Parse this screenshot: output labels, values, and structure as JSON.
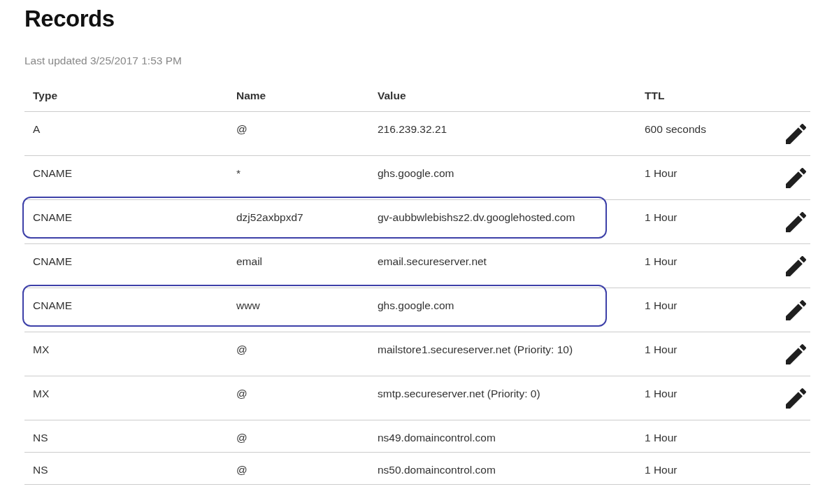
{
  "title": "Records",
  "last_updated": "Last updated 3/25/2017 1:53 PM",
  "table": {
    "columns": [
      "Type",
      "Name",
      "Value",
      "TTL"
    ],
    "rows": [
      {
        "type": "A",
        "name": "@",
        "value": "216.239.32.21",
        "ttl": "600 seconds",
        "editable": true,
        "highlighted": false
      },
      {
        "type": "CNAME",
        "name": "*",
        "value": "ghs.google.com",
        "ttl": "1 Hour",
        "editable": true,
        "highlighted": false
      },
      {
        "type": "CNAME",
        "name": "dzj52axbpxd7",
        "value": "gv-aubbwlebishsz2.dv.googlehosted.com",
        "ttl": "1 Hour",
        "editable": true,
        "highlighted": true
      },
      {
        "type": "CNAME",
        "name": "email",
        "value": "email.secureserver.net",
        "ttl": "1 Hour",
        "editable": true,
        "highlighted": false
      },
      {
        "type": "CNAME",
        "name": "www",
        "value": "ghs.google.com",
        "ttl": "1 Hour",
        "editable": true,
        "highlighted": true
      },
      {
        "type": "MX",
        "name": "@",
        "value": "mailstore1.secureserver.net (Priority: 10)",
        "ttl": "1 Hour",
        "editable": true,
        "highlighted": false
      },
      {
        "type": "MX",
        "name": "@",
        "value": "smtp.secureserver.net (Priority: 0)",
        "ttl": "1 Hour",
        "editable": true,
        "highlighted": false
      },
      {
        "type": "NS",
        "name": "@",
        "value": "ns49.domaincontrol.com",
        "ttl": "1 Hour",
        "editable": false,
        "highlighted": false
      },
      {
        "type": "NS",
        "name": "@",
        "value": "ns50.domaincontrol.com",
        "ttl": "1 Hour",
        "editable": false,
        "highlighted": false
      }
    ]
  }
}
